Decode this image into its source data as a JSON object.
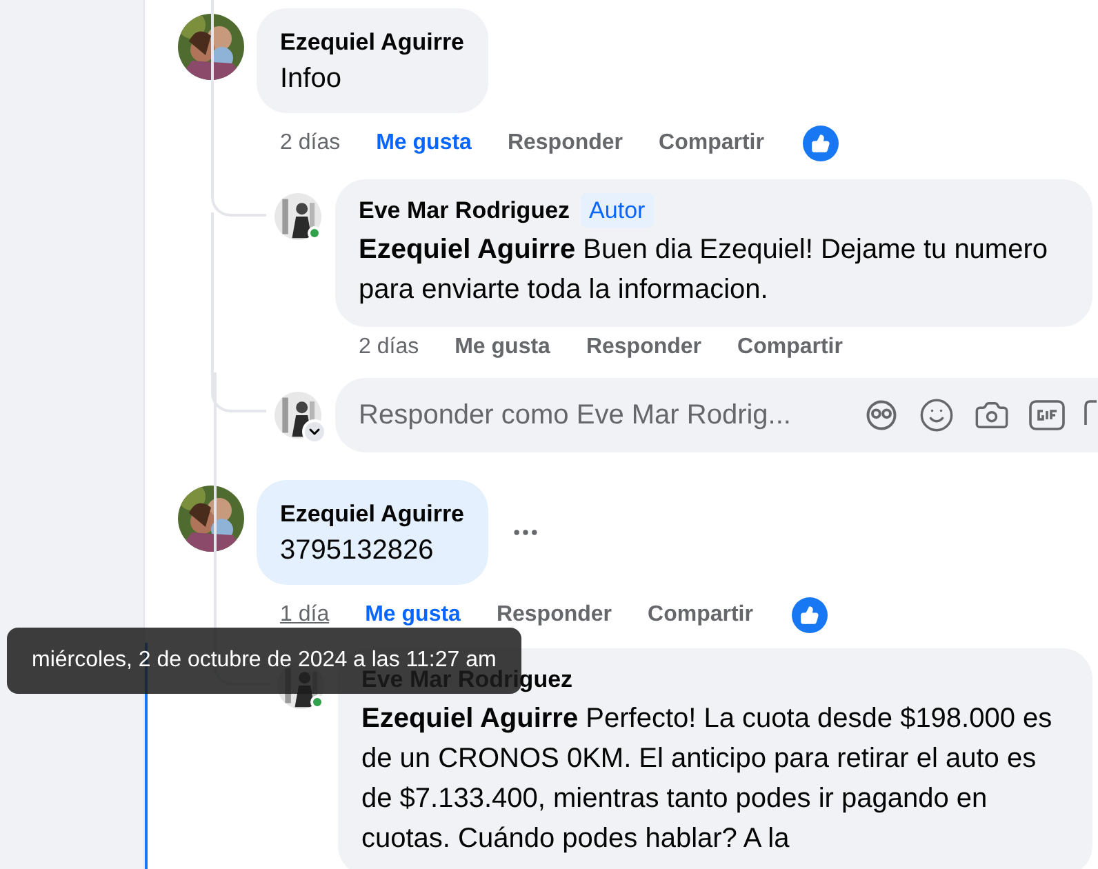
{
  "comments": [
    {
      "author": "Ezequiel Aguirre",
      "text": "Infoo",
      "highlighted": false,
      "menu_visible": false,
      "time": "2 días",
      "time_hovered": false,
      "like": "Me gusta",
      "liked": true,
      "reply": "Responder",
      "share": "Compartir",
      "has_reaction": true,
      "replies": [
        {
          "author": "Eve Mar Rodriguez",
          "badge": "Autor",
          "text": "**Ezequiel Aguirre** Buen dia Ezequiel! Dejame tu numero para enviarte toda la informacion.",
          "online": true,
          "time": "2 días",
          "like": "Me gusta",
          "liked": false,
          "reply": "Responder",
          "share": "Compartir"
        }
      ],
      "reply_box": {
        "placeholder": "Responder como Eve Mar Rodrig..."
      }
    },
    {
      "author": "Ezequiel Aguirre",
      "text": "3795132826",
      "highlighted": true,
      "menu_visible": true,
      "time": "1 día",
      "time_hovered": true,
      "like": "Me gusta",
      "liked": true,
      "reply": "Responder",
      "share": "Compartir",
      "has_reaction": true,
      "replies": [
        {
          "author": "Eve Mar Rodriguez",
          "text": "**Ezequiel Aguirre** Perfecto! La cuota desde $198.000 es de un CRONOS 0KM. El anticipo para retirar el auto es de $7.133.400, mientras tanto podes ir pagando en cuotas. Cuándo podes hablar? A la",
          "online": true
        }
      ]
    }
  ],
  "tooltip": {
    "text": "miércoles, 2 de octubre de 2024 a las 11:27 am"
  }
}
